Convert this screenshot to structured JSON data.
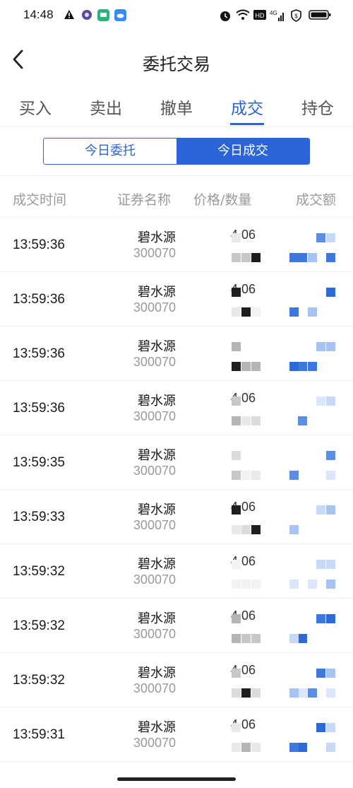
{
  "status_bar": {
    "time": "14:48",
    "left_icons": [
      "warning-icon",
      "app-dot-icon",
      "chat-icon",
      "cloud-icon"
    ],
    "right_icons": [
      "alarm-icon",
      "wifi-icon",
      "hd-icon",
      "signal-4g-icon",
      "shield-icon",
      "battery-icon"
    ]
  },
  "nav": {
    "title": "委托交易",
    "back_icon": "back-arrow-icon"
  },
  "tabs": [
    {
      "label": "买入"
    },
    {
      "label": "卖出"
    },
    {
      "label": "撤单"
    },
    {
      "label": "成交",
      "active": true
    },
    {
      "label": "持仓"
    }
  ],
  "segment": {
    "left": "今日委托",
    "right": "今日成交",
    "selected": "今日成交"
  },
  "table": {
    "headers": [
      "成交时间",
      "证券名称",
      "价格/数量",
      "成交额"
    ],
    "rows": [
      {
        "time": "13:59:36",
        "name": "碧水源",
        "code": "300070",
        "price": "4.06"
      },
      {
        "time": "13:59:36",
        "name": "碧水源",
        "code": "300070",
        "price": "4.06"
      },
      {
        "time": "13:59:36",
        "name": "碧水源",
        "code": "300070",
        "price": ""
      },
      {
        "time": "13:59:36",
        "name": "碧水源",
        "code": "300070",
        "price": "4.06"
      },
      {
        "time": "13:59:35",
        "name": "碧水源",
        "code": "300070",
        "price": ""
      },
      {
        "time": "13:59:33",
        "name": "碧水源",
        "code": "300070",
        "price": "4.06"
      },
      {
        "time": "13:59:32",
        "name": "碧水源",
        "code": "300070",
        "price": "4.06"
      },
      {
        "time": "13:59:32",
        "name": "碧水源",
        "code": "300070",
        "price": "4.06"
      },
      {
        "time": "13:59:32",
        "name": "碧水源",
        "code": "300070",
        "price": "4.06"
      },
      {
        "time": "13:59:31",
        "name": "碧水源",
        "code": "300070",
        "price": "4.06"
      }
    ]
  },
  "colors": {
    "accent": "#2a64d6",
    "muted_text": "#9a9a9a",
    "divider": "#eceef2"
  }
}
